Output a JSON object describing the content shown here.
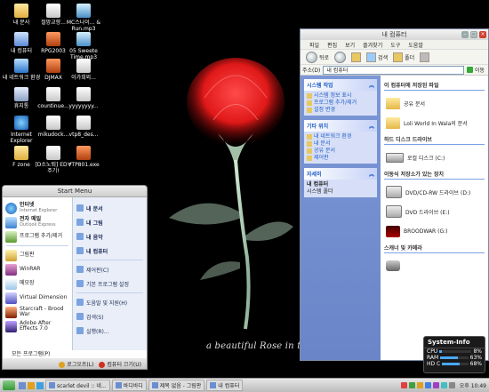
{
  "desktop": {
    "icons": [
      {
        "label": "내 문서"
      },
      {
        "label": "절망교향..."
      },
      {
        "label": "MC스나이... & Run.mp3"
      },
      {
        "label": "내 컴퓨터"
      },
      {
        "label": "RPG2003"
      },
      {
        "label": "05 Sweete Time.mp3"
      },
      {
        "label": "내 네트워크 환경"
      },
      {
        "label": "DJMAX"
      },
      {
        "label": "이가희외..."
      },
      {
        "label": "휴지통"
      },
      {
        "label": "countinue..."
      },
      {
        "label": "yyyyyyyy..."
      },
      {
        "label": "Internet Explorer"
      },
      {
        "label": "mikudock..."
      },
      {
        "label": "vtp8_des..."
      },
      {
        "label": "F zone"
      },
      {
        "label": "[D소노퇴] ED * 주기!"
      },
      {
        "label": "VTP801.exe"
      }
    ],
    "wallpaper_caption": "a beautiful Rose in the Dark"
  },
  "explorer": {
    "title": "내 컴퓨터",
    "menu": [
      "파일",
      "편집",
      "보기",
      "즐겨찾기",
      "도구",
      "도움말"
    ],
    "toolbar": {
      "back": "뒤로",
      "search": "검색",
      "folders": "폴더"
    },
    "address_label": "주소(D)",
    "address_value": "내 컴퓨터",
    "go_label": "이동",
    "tasks": {
      "system": {
        "header": "시스템 작업",
        "items": [
          "시스템 정보 표시",
          "프로그램 추가/제거",
          "설정 변경"
        ]
      },
      "other": {
        "header": "기타 위치",
        "items": [
          "내 네트워크 환경",
          "내 문서",
          "공유 문서",
          "제어판"
        ]
      },
      "details": {
        "header": "자세히",
        "name": "내 컴퓨터",
        "sub": "시스템 폴더"
      }
    },
    "groups": [
      {
        "header": "이 컴퓨터에 저장된 파일",
        "items": [
          "공유 문서",
          "Loli World In Wala의 문서"
        ]
      },
      {
        "header": "하드 디스크 드라이브",
        "items": [
          "로컬 디스크 (C:)"
        ]
      },
      {
        "header": "이동식 저장소가 있는 장치",
        "items": [
          "DVD/CD-RW 드라이브 (D:)",
          "DVD 드라이브 (E:)",
          "BROODWAR (G:)"
        ]
      },
      {
        "header": "스캐너 및 카메라",
        "items": []
      }
    ]
  },
  "start_menu": {
    "title": "Start Menu",
    "left_items": [
      {
        "title": "인터넷",
        "sub": "Internet Explorer"
      },
      {
        "title": "전자 메일",
        "sub": "Outlook Express"
      },
      {
        "title": "프로그램 추가/제거",
        "sub": ""
      },
      {
        "title": "그림판",
        "sub": ""
      },
      {
        "title": "WinRAR",
        "sub": ""
      },
      {
        "title": "메모장",
        "sub": ""
      },
      {
        "title": "Virtual Dimension",
        "sub": ""
      },
      {
        "title": "Starcraft - Brood War",
        "sub": ""
      },
      {
        "title": "Adobe After Effects 7.0",
        "sub": ""
      }
    ],
    "all_programs": "모든 프로그램(P)",
    "right_items": [
      "내 문서",
      "내 그림",
      "내 음악",
      "내 컴퓨터",
      "제어판(C)",
      "기본 프로그램 설정",
      "도움말 및 지원(H)",
      "검색(S)",
      "실행(R)..."
    ],
    "logoff": "로그오프(L)",
    "shutdown": "컴퓨터 끄기(U)"
  },
  "taskbar": {
    "items": [
      "scarlet devil :: 네...",
      "바디바디",
      "제목 없음 - 그림판",
      "내 컴퓨터"
    ],
    "clock": "오후 10:49"
  },
  "sysinfo": {
    "title": "System-Info",
    "rows": [
      {
        "label": "CPU",
        "value": "8%",
        "level": 0.08
      },
      {
        "label": "RAM",
        "value": "63%",
        "level": 0.63
      },
      {
        "label": "HD C",
        "value": "68%",
        "level": 0.68
      }
    ]
  }
}
